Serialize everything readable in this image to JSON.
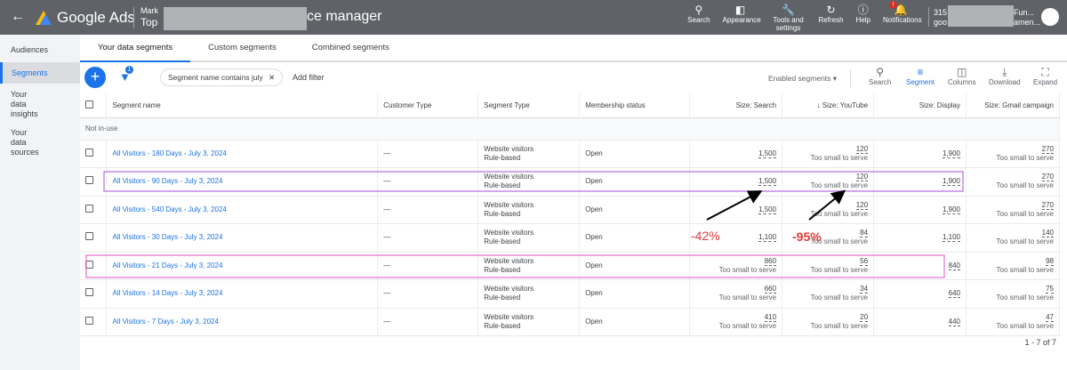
{
  "header": {
    "product": "Google Ads",
    "account_line1": "Mark",
    "account_line2": "Top",
    "title_suffix": "ce manager",
    "account_id": "315",
    "account_email": "goo",
    "account_name": "Fun...",
    "account_sub": "amen...",
    "tools": [
      {
        "icon": "search-icon",
        "label": "Search"
      },
      {
        "icon": "appearance-icon",
        "label": "Appearance"
      },
      {
        "icon": "wrench-icon",
        "label": "Tools and settings"
      },
      {
        "icon": "refresh-icon",
        "label": "Refresh"
      },
      {
        "icon": "help-icon",
        "label": "Help"
      },
      {
        "icon": "bell-icon",
        "label": "Notifications"
      }
    ],
    "notif_badge": "!"
  },
  "sidebar": [
    "Audiences",
    "Segments",
    "Your data insights",
    "Your data sources"
  ],
  "tabs": [
    "Your data segments",
    "Custom segments",
    "Combined segments"
  ],
  "toolbar": {
    "filter_count": "1",
    "filter_chip": "Segment name contains july",
    "add_filter": "Add filter",
    "view_select": "Enabled segments",
    "buttons": [
      "Search",
      "Segment",
      "Columns",
      "Download",
      "Expand"
    ]
  },
  "table": {
    "headers": [
      "Segment name",
      "Customer Type",
      "Segment Type",
      "Membership status",
      "Size: Search",
      "Size: YouTube",
      "Size: Display",
      "Size: Gmail campaign"
    ],
    "group": "Not in-use",
    "rows": [
      {
        "name": "All Visitors - 180 Days - July 3, 2024",
        "customer": "—",
        "type1": "Website visitors",
        "type2": "Rule-based",
        "status": "Open",
        "search": "1,500",
        "search_note": "",
        "youtube": "120",
        "youtube_note": "Too small to serve",
        "display": "1,900",
        "gmail": "270",
        "gmail_note": "Too small to serve"
      },
      {
        "name": "All Visitors - 90 Days - July 3, 2024",
        "customer": "—",
        "type1": "Website visitors",
        "type2": "Rule-based",
        "status": "Open",
        "search": "1,500",
        "search_note": "",
        "youtube": "120",
        "youtube_note": "Too small to serve",
        "display": "1,900",
        "gmail": "270",
        "gmail_note": "Too small to serve"
      },
      {
        "name": "All Visitors - 540 Days - July 3, 2024",
        "customer": "—",
        "type1": "Website visitors",
        "type2": "Rule-based",
        "status": "Open",
        "search": "1,500",
        "search_note": "",
        "youtube": "120",
        "youtube_note": "Too small to serve",
        "display": "1,900",
        "gmail": "270",
        "gmail_note": "Too small to serve"
      },
      {
        "name": "All Visitors - 30 Days - July 3, 2024",
        "customer": "—",
        "type1": "Website visitors",
        "type2": "Rule-based",
        "status": "Open",
        "search": "1,100",
        "search_note": "",
        "youtube": "84",
        "youtube_note": "Too small to serve",
        "display": "1,100",
        "gmail": "140",
        "gmail_note": "Too small to serve"
      },
      {
        "name": "All Visitors - 21 Days - July 3, 2024",
        "customer": "—",
        "type1": "Website visitors",
        "type2": "Rule-based",
        "status": "Open",
        "search": "860",
        "search_note": "Too small to serve",
        "youtube": "56",
        "youtube_note": "Too small to serve",
        "display": "840",
        "gmail": "98",
        "gmail_note": "Too small to serve"
      },
      {
        "name": "All Visitors - 14 Days - July 3, 2024",
        "customer": "—",
        "type1": "Website visitors",
        "type2": "Rule-based",
        "status": "Open",
        "search": "660",
        "search_note": "Too small to serve",
        "youtube": "34",
        "youtube_note": "Too small to serve",
        "display": "640",
        "gmail": "75",
        "gmail_note": "Too small to serve"
      },
      {
        "name": "All Visitors - 7 Days - July 3, 2024",
        "customer": "—",
        "type1": "Website visitors",
        "type2": "Rule-based",
        "status": "Open",
        "search": "410",
        "search_note": "Too small to serve",
        "youtube": "20",
        "youtube_note": "Too small to serve",
        "display": "440",
        "gmail": "47",
        "gmail_note": "Too small to serve"
      }
    ]
  },
  "pagination": "1 - 7 of 7",
  "annotations": {
    "search_drop": "-42%",
    "youtube_drop": "-95%",
    "color": "#e53935"
  }
}
